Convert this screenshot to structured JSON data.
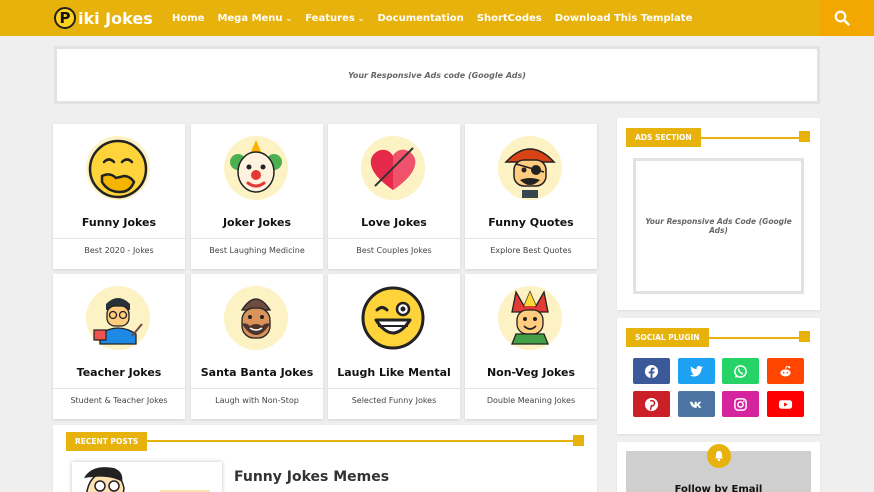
{
  "header": {
    "logo_letter": "P",
    "logo_text": "iki Jokes",
    "nav": [
      {
        "label": "Home",
        "dropdown": false
      },
      {
        "label": "Mega Menu",
        "dropdown": true
      },
      {
        "label": "Features",
        "dropdown": true
      },
      {
        "label": "Documentation",
        "dropdown": false
      },
      {
        "label": "ShortCodes",
        "dropdown": false
      },
      {
        "label": "Download This Template",
        "dropdown": false
      }
    ],
    "search_icon": "search-icon"
  },
  "top_ad": {
    "text": "Your Responsive Ads code (Google Ads)"
  },
  "cards": [
    {
      "title": "Funny Jokes",
      "subtitle": "Best 2020 - Jokes",
      "icon": "laughing-face-icon"
    },
    {
      "title": "Joker Jokes",
      "subtitle": "Best Laughing Medicine",
      "icon": "clown-icon"
    },
    {
      "title": "Love Jokes",
      "subtitle": "Best Couples Jokes",
      "icon": "heart-icon"
    },
    {
      "title": "Funny Quotes",
      "subtitle": "Explore Best Quotes",
      "icon": "pirate-icon"
    },
    {
      "title": "Teacher Jokes",
      "subtitle": "Student & Teacher Jokes",
      "icon": "teacher-icon"
    },
    {
      "title": "Santa Banta Jokes",
      "subtitle": "Laugh with Non-Stop",
      "icon": "bearded-man-icon"
    },
    {
      "title": "Laugh Like Mental",
      "subtitle": "Selected Funny Jokes",
      "icon": "winking-face-icon"
    },
    {
      "title": "Non-Veg Jokes",
      "subtitle": "Double Meaning Jokes",
      "icon": "jester-icon"
    }
  ],
  "recent_posts": {
    "label": "RECENT POSTS",
    "first_post_title": "Funny Jokes Memes"
  },
  "sidebar": {
    "ads_section": {
      "label": "ADS SECTION",
      "text": "Your Responsive Ads Code (Google Ads)"
    },
    "social_plugin": {
      "label": "SOCIAL PLUGIN",
      "buttons": [
        {
          "name": "facebook",
          "color": "#3b5998"
        },
        {
          "name": "twitter",
          "color": "#1da1f2"
        },
        {
          "name": "whatsapp",
          "color": "#25d366"
        },
        {
          "name": "reddit",
          "color": "#ff4500"
        },
        {
          "name": "pinterest",
          "color": "#cb2027"
        },
        {
          "name": "vk",
          "color": "#4c75a3"
        },
        {
          "name": "instagram",
          "color": "#d6249f"
        },
        {
          "name": "youtube",
          "color": "#ff0000"
        }
      ]
    },
    "follow": {
      "text": "Follow by Email"
    }
  },
  "colors": {
    "accent": "#e8b20c",
    "background": "#efefef"
  }
}
